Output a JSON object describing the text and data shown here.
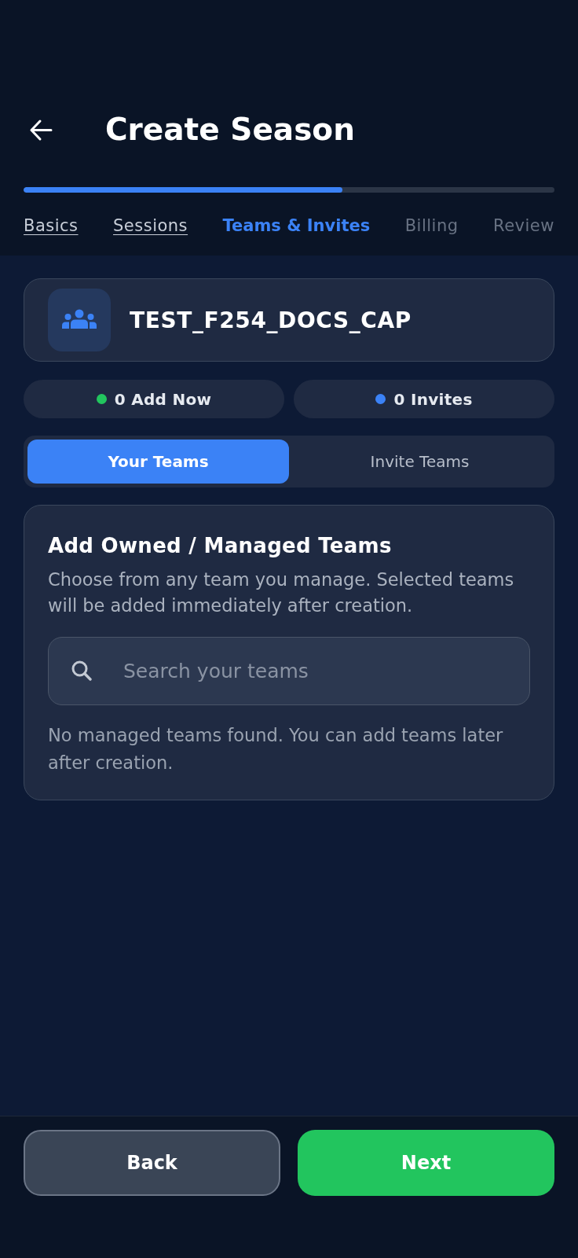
{
  "header": {
    "title": "Create Season",
    "progress": {
      "level": 0.6
    }
  },
  "steps": [
    {
      "label": "Basics",
      "selected": false,
      "completed": true
    },
    {
      "label": "Sessions",
      "selected": false,
      "completed": true
    },
    {
      "label": "Teams & Invites",
      "selected": true,
      "completed": false
    },
    {
      "label": "Billing",
      "selected": false,
      "completed": false
    },
    {
      "label": "Review",
      "selected": false,
      "completed": false
    }
  ],
  "team": {
    "name": "TEST_F254_DOCS_CAP"
  },
  "counters": [
    {
      "label": "0 Add Now",
      "color": "#22c55e"
    },
    {
      "label": "0 Invites",
      "color": "#3b82f6"
    }
  ],
  "segments": [
    {
      "label": "Your Teams",
      "selected": true
    },
    {
      "label": "Invite Teams",
      "selected": false
    }
  ],
  "panel": {
    "title": "Add Owned / Managed Teams",
    "description": "Choose from any team you manage. Selected teams will be added immediately after creation.",
    "search": {
      "placeholder": "Search your teams"
    },
    "empty_message": "No managed teams found. You can add teams later after creation."
  },
  "footer": {
    "buttons": [
      {
        "label": "Back",
        "kind": "secondary"
      },
      {
        "label": "Next",
        "kind": "primary"
      }
    ]
  }
}
